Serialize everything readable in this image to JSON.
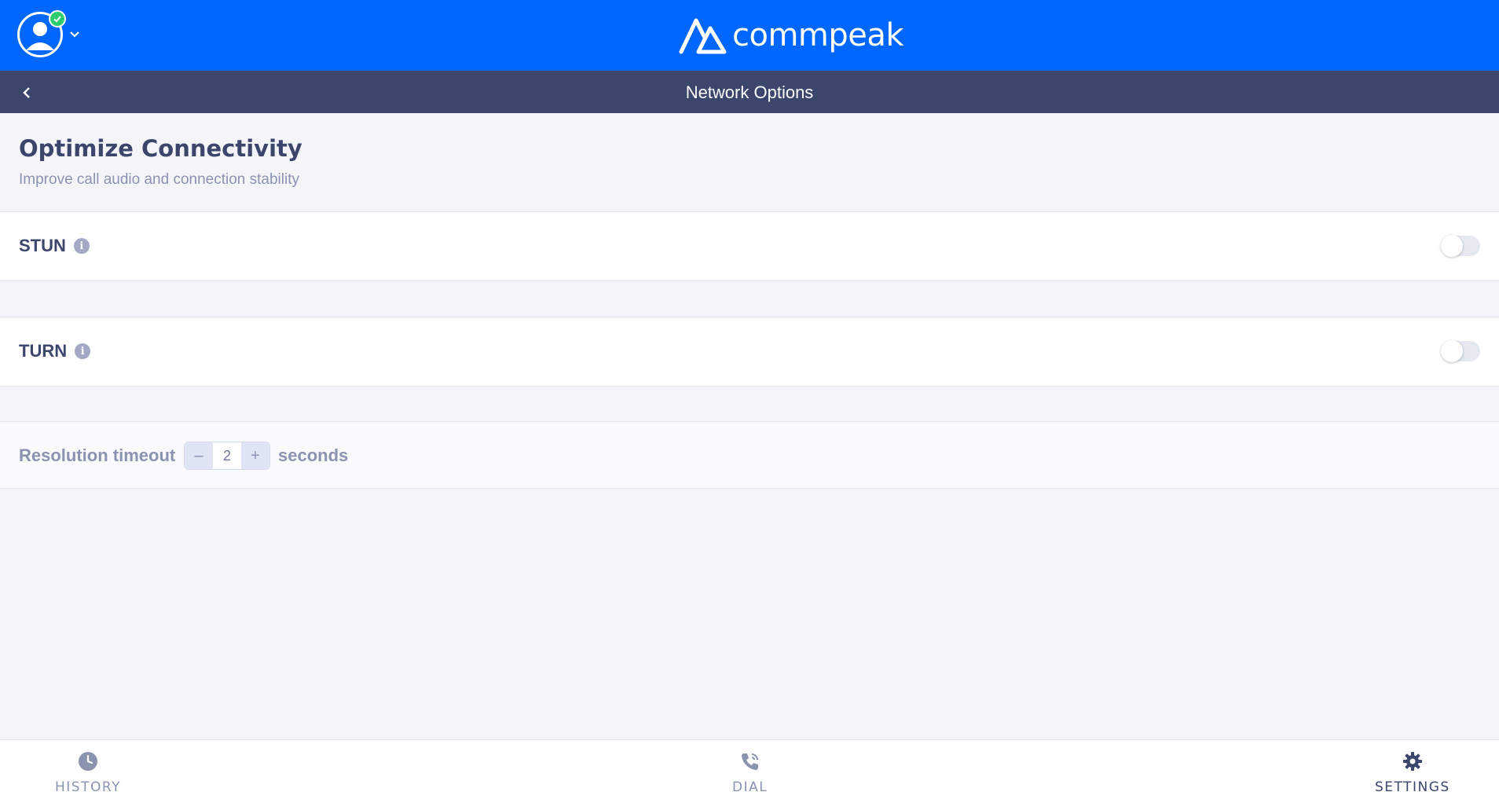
{
  "header": {
    "brand_name": "commpeak",
    "avatar_icon": "user-avatar-icon",
    "status_color": "#2ecc71",
    "accent_color": "#0067fe"
  },
  "subheader": {
    "title": "Network Options",
    "back_icon": "chevron-left-icon"
  },
  "section": {
    "title": "Optimize Connectivity",
    "subtitle": "Improve call audio and connection stability"
  },
  "settings": [
    {
      "label": "STUN",
      "enabled": false
    },
    {
      "label": "TURN",
      "enabled": false
    }
  ],
  "timeout": {
    "label": "Resolution timeout",
    "decrement": "–",
    "value": "2",
    "increment": "+",
    "unit": "seconds"
  },
  "nav": [
    {
      "label": "HISTORY",
      "icon": "clock-icon",
      "active": false
    },
    {
      "label": "DIAL",
      "icon": "phone-icon",
      "active": false
    },
    {
      "label": "SETTINGS",
      "icon": "gear-icon",
      "active": true
    }
  ]
}
